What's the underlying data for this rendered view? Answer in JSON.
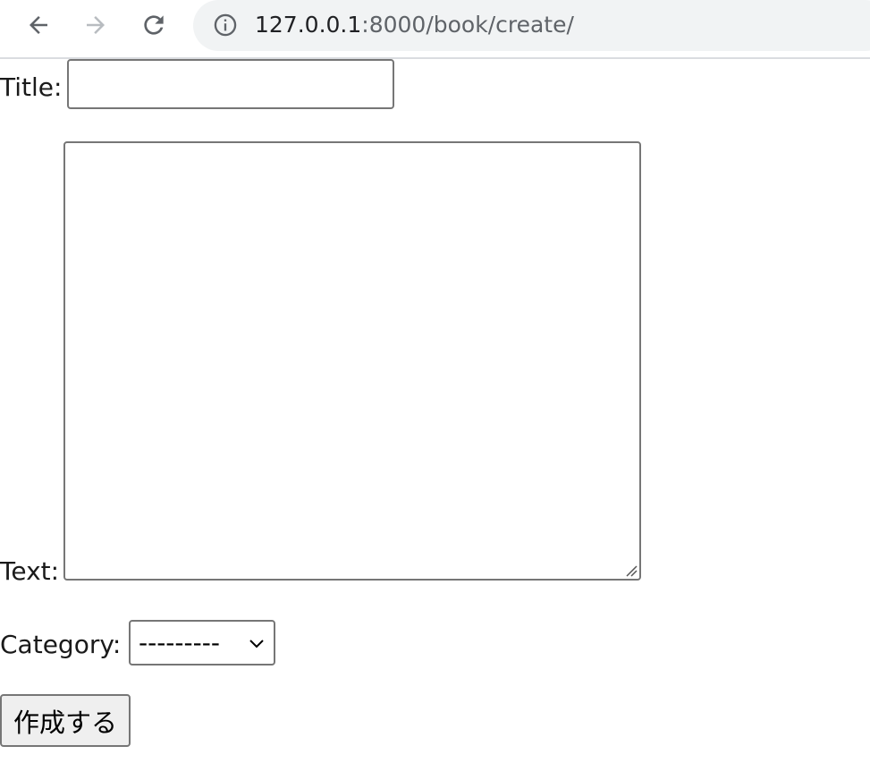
{
  "browser": {
    "back_icon": "arrow-left-icon",
    "forward_icon": "arrow-right-icon",
    "reload_icon": "reload-icon",
    "site_info_icon": "info-icon",
    "url_host": "127.0.0.1",
    "url_path": ":8000/book/create/"
  },
  "form": {
    "title_label": "Title:",
    "title_value": "",
    "text_label": "Text:",
    "text_value": "",
    "category_label": "Category:",
    "category_selected": "---------",
    "submit_label": "作成する"
  },
  "colors": {
    "toolbar_bg": "#ffffff",
    "omnibox_bg": "#f1f3f4",
    "button_bg": "#efefef",
    "input_border": "#767676"
  }
}
